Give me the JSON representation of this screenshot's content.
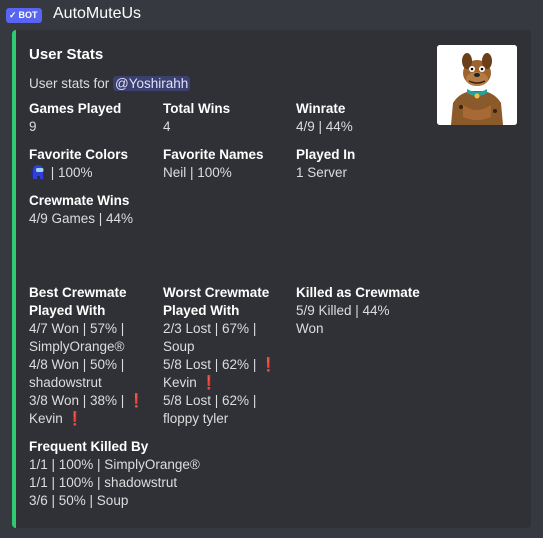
{
  "message": {
    "bot_tag": "BOT",
    "bot_name": "AutoMuteUs"
  },
  "embed": {
    "accent_color": "#2ecc71",
    "title": "User Stats",
    "description_prefix": "User stats for ",
    "mention": "@Yoshirahh",
    "thumbnail_icon": "scooby-doo-avatar",
    "fields": {
      "games_played": {
        "name": "Games Played",
        "value": "9"
      },
      "total_wins": {
        "name": "Total Wins",
        "value": "4"
      },
      "winrate": {
        "name": "Winrate",
        "value": "4/9 | 44%"
      },
      "favorite_colors": {
        "name": "Favorite Colors",
        "value": " | 100%",
        "icon": "blue-crewmate-icon"
      },
      "favorite_names": {
        "name": "Favorite Names",
        "value": "Neil | 100%"
      },
      "played_in": {
        "name": "Played In",
        "value": "1 Server"
      },
      "crewmate_wins": {
        "name": "Crewmate Wins",
        "value": "4/9 Games | 44%"
      },
      "best_crewmate": {
        "name_line1": "Best Crewmate",
        "name_line2": "Played With",
        "lines": [
          "4/7 Won | 57% |",
          "SimplyOrange®",
          "4/8 Won | 50% |",
          "shadowstrut",
          "3/8 Won | 38% |",
          "Kevin"
        ]
      },
      "worst_crewmate": {
        "name_line1": "Worst Crewmate",
        "name_line2": "Played With",
        "lines": [
          "2/3 Lost | 67% |",
          "Soup",
          "5/8 Lost | 62% |",
          "Kevin",
          "5/8 Lost | 62% |",
          "floppy tyler"
        ]
      },
      "killed_as_crewmate": {
        "name": "Killed as Crewmate",
        "lines": [
          "5/9 Killed | 44%",
          "Won"
        ]
      },
      "frequent_killed_by": {
        "name": "Frequent Killed By",
        "lines": [
          "1/1 | 100% | SimplyOrange®",
          "1/1 | 100% | shadowstrut",
          "3/6 | 50% | Soup"
        ]
      }
    },
    "excl_mark": "❗"
  }
}
